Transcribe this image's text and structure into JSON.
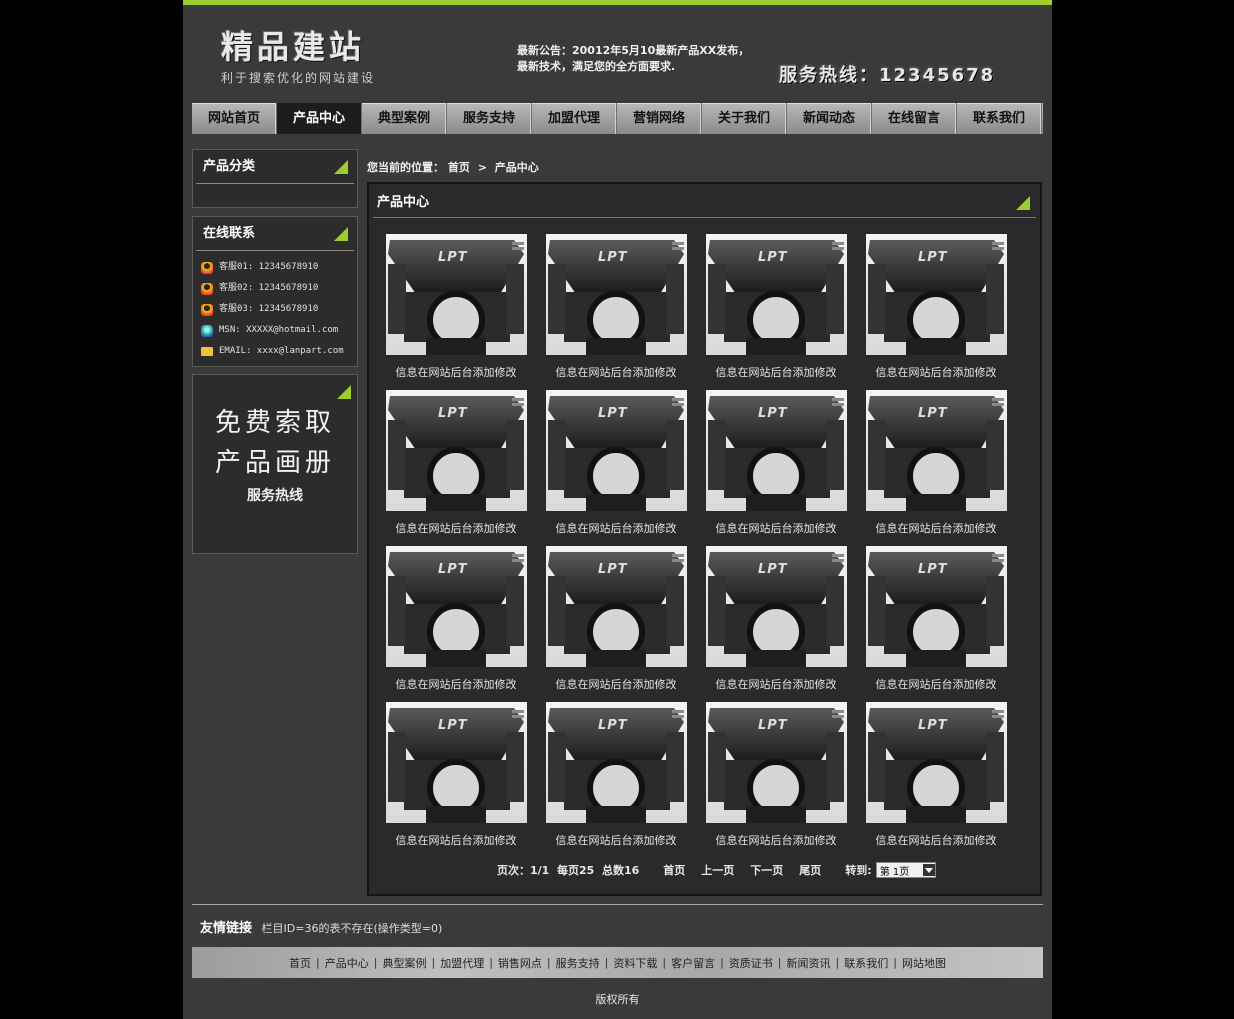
{
  "header": {
    "logo_title": "精品建站",
    "logo_subtitle": "利于搜索优化的网站建设",
    "notice_line1": "最新公告：20012年5月10最新产品XX发布，",
    "notice_line2": "最新技术，满足您的全方面要求.",
    "hotline": "服务热线：12345678"
  },
  "nav": {
    "items": [
      "网站首页",
      "产品中心",
      "典型案例",
      "服务支持",
      "加盟代理",
      "营销网络",
      "关于我们",
      "新闻动态",
      "在线留言",
      "联系我们"
    ],
    "active_index": 1
  },
  "sidebar": {
    "category_title": "产品分类",
    "contact_title": "在线联系",
    "contacts": [
      {
        "icon": "qq-icon",
        "text": "客服01: 12345678910"
      },
      {
        "icon": "qq-icon",
        "text": "客服02: 12345678910"
      },
      {
        "icon": "qq-icon",
        "text": "客服03: 12345678910"
      },
      {
        "icon": "msn-icon",
        "text": "MSN: XXXXX@hotmail.com"
      },
      {
        "icon": "mail-icon",
        "text": "EMAIL: xxxx@lanpart.com"
      }
    ],
    "promo_line1": "免费索取",
    "promo_line2": "产品画册",
    "promo_line3": "服务热线"
  },
  "breadcrumb": {
    "prefix": "您当前的位置：",
    "home": "首页",
    "separator": ">",
    "current": "产品中心"
  },
  "main": {
    "title": "产品中心",
    "products": [
      {
        "caption": "信息在网站后台添加修改"
      },
      {
        "caption": "信息在网站后台添加修改"
      },
      {
        "caption": "信息在网站后台添加修改"
      },
      {
        "caption": "信息在网站后台添加修改"
      },
      {
        "caption": "信息在网站后台添加修改"
      },
      {
        "caption": "信息在网站后台添加修改"
      },
      {
        "caption": "信息在网站后台添加修改"
      },
      {
        "caption": "信息在网站后台添加修改"
      },
      {
        "caption": "信息在网站后台添加修改"
      },
      {
        "caption": "信息在网站后台添加修改"
      },
      {
        "caption": "信息在网站后台添加修改"
      },
      {
        "caption": "信息在网站后台添加修改"
      },
      {
        "caption": "信息在网站后台添加修改"
      },
      {
        "caption": "信息在网站后台添加修改"
      },
      {
        "caption": "信息在网站后台添加修改"
      },
      {
        "caption": "信息在网站后台添加修改"
      }
    ],
    "product_logo": "LPT"
  },
  "pager": {
    "page_info": "页次：1/1",
    "per_page": "每页25",
    "total": "总数16",
    "first": "首页",
    "prev": "上一页",
    "next": "下一页",
    "last": "尾页",
    "goto_label": "转到:",
    "goto_value": "第 1页"
  },
  "footer": {
    "links_title": "友情链接",
    "links_text": "栏目ID=36的表不存在(操作类型=0)",
    "nav": [
      "首页",
      "产品中心",
      "典型案例",
      "加盟代理",
      "销售网点",
      "服务支持",
      "资料下载",
      "客户留言",
      "资质证书",
      "新闻资讯",
      "联系我们",
      "网站地图"
    ],
    "copyright": "版权所有"
  },
  "colors": {
    "accent": "#9ccc2e",
    "page_bg": "#3a3a3a",
    "outer_bg": "#000000"
  }
}
